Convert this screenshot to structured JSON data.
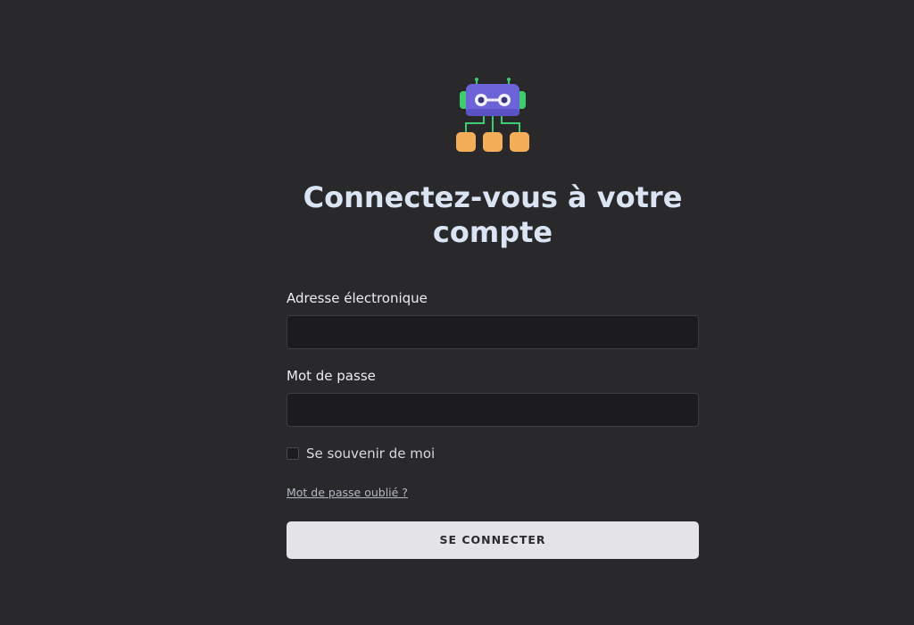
{
  "logo": {
    "icon": "robot-icon",
    "colors": {
      "head": "#6C63D9",
      "eyes": "#F1F1FB",
      "ears": "#3FCB6F",
      "wires": "#3FCB6F",
      "nodes": "#F4AE5A"
    }
  },
  "page": {
    "title": "Connectez-vous à votre compte"
  },
  "form": {
    "email_label": "Adresse électronique",
    "email_value": "",
    "password_label": "Mot de passe",
    "password_value": "",
    "remember_label": "Se souvenir de moi",
    "remember_checked": false,
    "forgot_link": "Mot de passe oublié ?",
    "submit_label": "SE CONNECTER"
  }
}
